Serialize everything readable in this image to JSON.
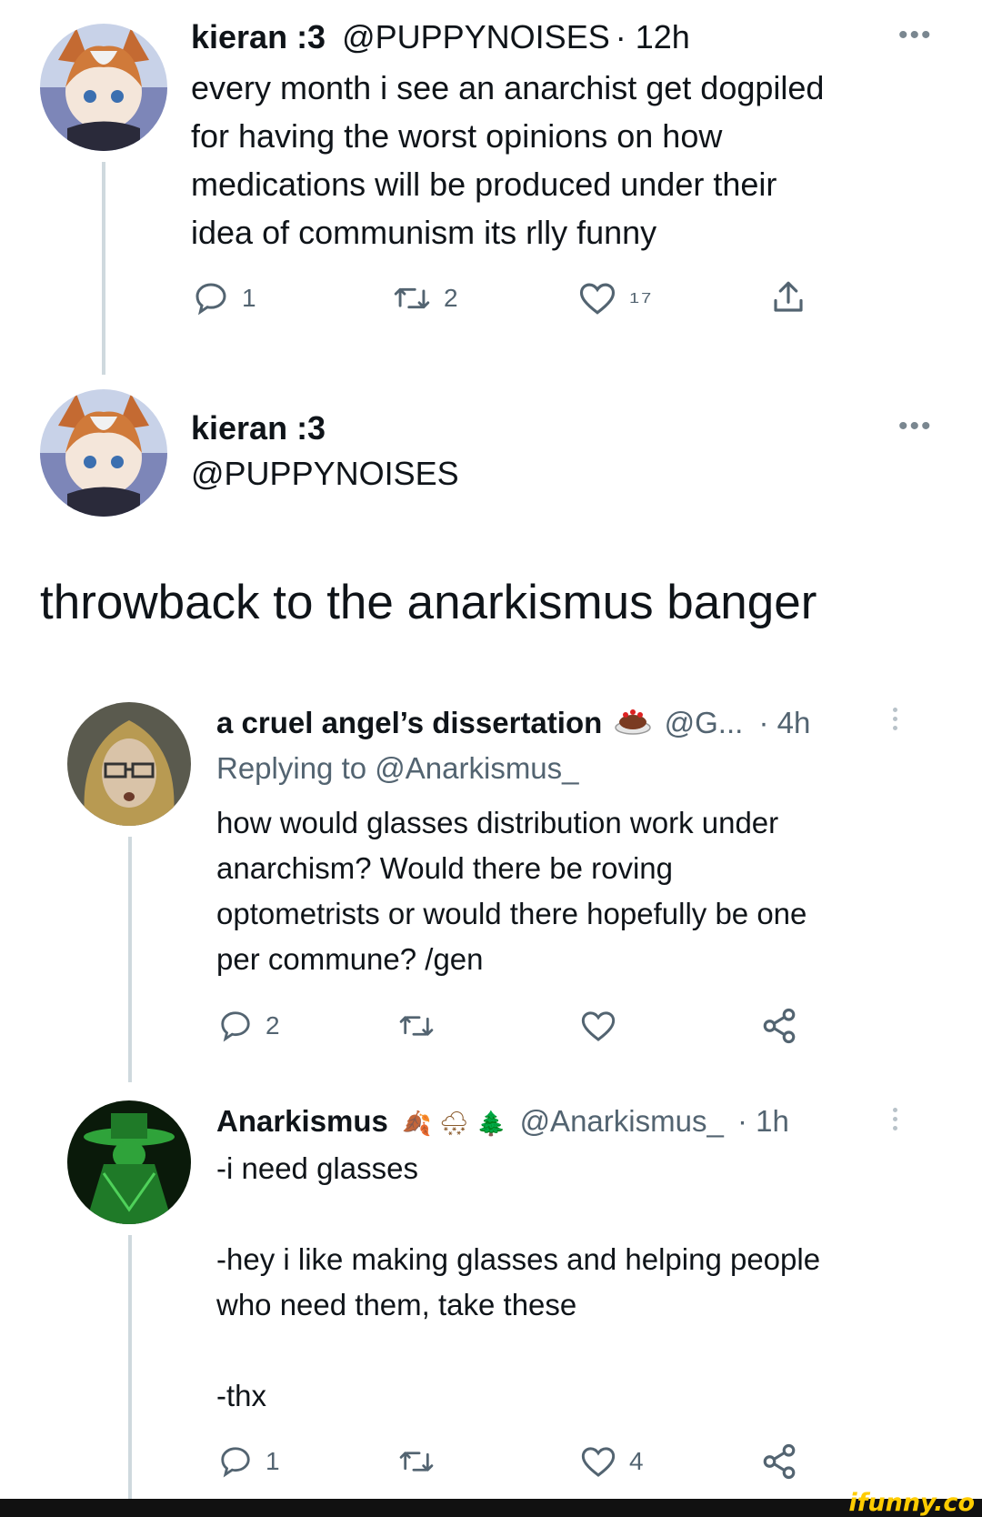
{
  "tweet1": {
    "name": "kieran :3",
    "handle": "@PUPPYNOISES",
    "time": "· 12h",
    "text_lines": [
      "every month i see an anarchist get dogpiled",
      "for having the worst opinions on how",
      "medications will be produced under their",
      "idea of communism its rlly funny"
    ],
    "replies": "1",
    "retweets": "2",
    "likes": "17"
  },
  "tweet2": {
    "name": "kieran :3",
    "handle": "@PUPPYNOISES",
    "text": "throwback to the anarkismus banger"
  },
  "reply1": {
    "name": "a cruel angel’s dissertation",
    "handle": "@G...",
    "time": "· 4h",
    "replying_prefix": "Replying to",
    "replying_to": "@Anarkismus_",
    "text_lines": [
      "how would glasses distribution work under",
      "anarchism? Would there be roving",
      "optometrists or would there hopefully be one",
      "per commune? /gen"
    ],
    "replies": "2"
  },
  "reply2": {
    "name": "Anarkismus",
    "emojis": "🍂 🌨 🌲",
    "handle": "@Anarkismus_",
    "time": "· 1h",
    "line1": "-i need glasses",
    "line2a": "-hey i like making glasses and helping people",
    "line2b": "who need them, take these",
    "line3": "-thx",
    "replies": "1",
    "likes": "4"
  },
  "watermark": "ifunny.co",
  "colors": {
    "text": "#0f1419",
    "muted": "#536471",
    "thread_line": "#cfd9de",
    "footer": "#111111",
    "watermark": "#ffcc00"
  },
  "icons": [
    "reply-icon",
    "retweet-icon",
    "like-icon",
    "share-icon",
    "nodes-share-icon",
    "more-icon"
  ]
}
